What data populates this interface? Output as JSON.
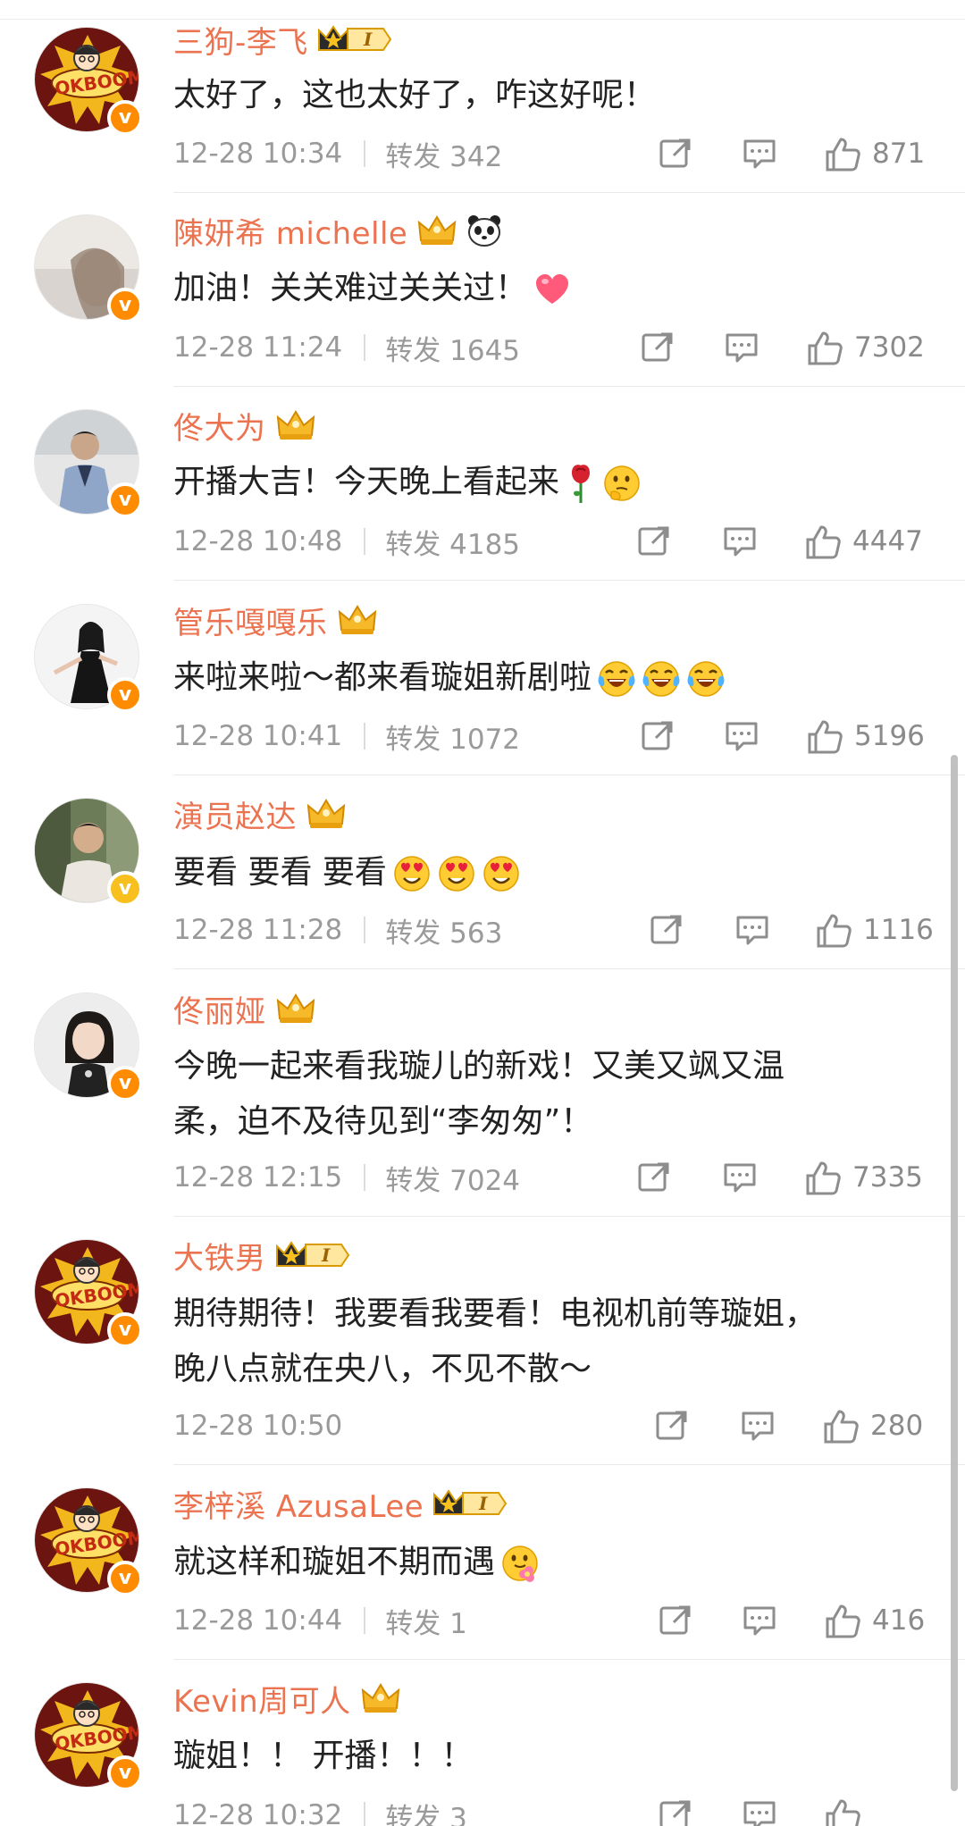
{
  "comments": [
    {
      "name": "三狗-李飞",
      "crown": "king-crown-level-1",
      "level": "I",
      "text": "太好了，这也太好了，咋这好呢！",
      "emojis": [],
      "date": "12-28 10:34",
      "repost": "转发 342",
      "likes": "871",
      "avatar": "okboom",
      "badge": "orange"
    },
    {
      "name": "陳妍希 michelle",
      "crown": "gold-crown",
      "extra_badge": "panda-icon",
      "text": "加油！关关难过关关过！",
      "emojis": [
        "heart"
      ],
      "date": "12-28 11:24",
      "repost": "转发 1645",
      "likes": "7302",
      "avatar": "woman-light",
      "badge": "orange"
    },
    {
      "name": "佟大为",
      "crown": "gold-crown",
      "text": "开播大吉！今天晚上看起来",
      "emojis": [
        "rose",
        "thinking"
      ],
      "date": "12-28 10:48",
      "repost": "转发 4185",
      "likes": "4447",
      "avatar": "man-suit",
      "badge": "orange"
    },
    {
      "name": "管乐嘎嘎乐",
      "crown": "gold-crown",
      "text": "来啦来啦～都来看璇姐新剧啦",
      "emojis": [
        "laugh-cry",
        "laugh-cry",
        "laugh-cry"
      ],
      "date": "12-28 10:41",
      "repost": "转发 1072",
      "likes": "5196",
      "avatar": "woman-black-dress",
      "badge": "orange"
    },
    {
      "name": "演员赵达",
      "crown": "gold-crown",
      "text": "要看 要看 要看",
      "emojis": [
        "heart-eyes",
        "heart-eyes",
        "heart-eyes"
      ],
      "date": "12-28 11:28",
      "repost": "转发 563",
      "likes": "1116",
      "avatar": "man-outdoor",
      "badge": "gold"
    },
    {
      "name": "佟丽娅",
      "crown": "gold-crown",
      "text_lines": [
        "今晚一起来看我璇儿的新戏！又美又飒又温",
        "柔，迫不及待见到“李匆匆”！"
      ],
      "emojis": [],
      "date": "12-28 12:15",
      "repost": "转发 7024",
      "likes": "7335",
      "avatar": "woman-short-hair",
      "badge": "orange"
    },
    {
      "name": "大铁男",
      "crown": "king-crown-level-1",
      "level": "I",
      "text_lines": [
        "期待期待！我要看我要看！电视机前等璇姐，",
        "晚八点就在央八，不见不散～"
      ],
      "emojis": [],
      "date": "12-28 10:50",
      "repost": "",
      "likes": "280",
      "avatar": "okboom",
      "badge": "orange"
    },
    {
      "name": "李梓溪 AzusaLee",
      "crown": "king-crown-level-1",
      "level": "I",
      "text": "就这样和璇姐不期而遇",
      "emojis": [
        "flower-face"
      ],
      "date": "12-28 10:44",
      "repost": "转发 1",
      "likes": "416",
      "avatar": "okboom",
      "badge": "orange"
    },
    {
      "name": "Kevin周可人",
      "crown": "gold-crown",
      "text": "璇姐！！ 开播！！！",
      "emojis": [],
      "date": "12-28 10:32",
      "repost": "转发 3",
      "likes": "",
      "avatar": "okboom",
      "badge": "orange"
    }
  ],
  "colors": {
    "name": "#eb7350",
    "meta": "#9a9a9a",
    "badge_orange": "#ff8c00",
    "badge_gold": "#f7c01e"
  }
}
